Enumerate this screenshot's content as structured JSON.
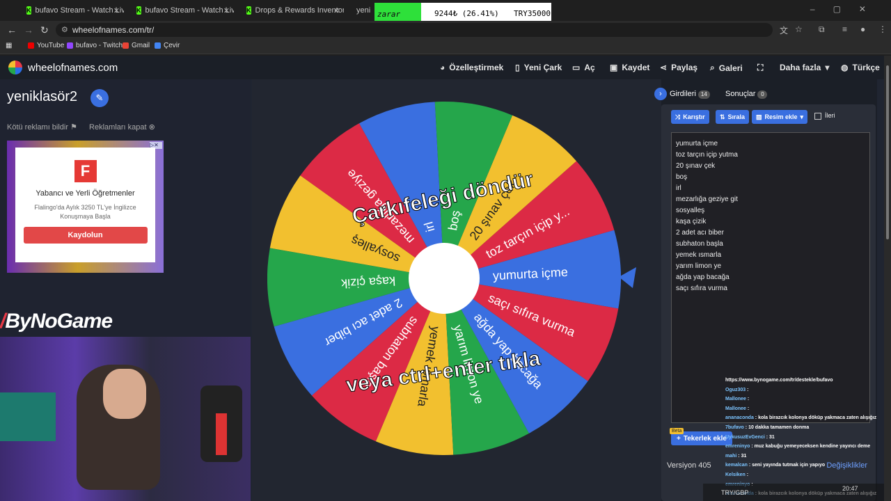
{
  "browser": {
    "tabs": [
      {
        "label": "bufavo Stream - Watch Live on"
      },
      {
        "label": "bufavo Stream - Watch Live on"
      },
      {
        "label": "Drops & Rewards Inventory - K"
      },
      {
        "label": "yeni"
      }
    ],
    "url": "wheelofnames.com/tr/",
    "bookmarks": [
      "YouTube",
      "bufavo - Twitch",
      "Gmail",
      "Çevir"
    ]
  },
  "stock_overlay": {
    "label": "zarar",
    "value1": "9244₺ (26.41%)",
    "value2": "TRY35000"
  },
  "site": {
    "brand": "wheelofnames.com",
    "nav": {
      "customize": "Özelleştirmek",
      "new_wheel": "Yeni Çark",
      "open": "Aç",
      "save": "Kaydet",
      "share": "Paylaş",
      "gallery": "Galeri",
      "more": "Daha fazla",
      "language": "Türkçe"
    },
    "wheel_title": "yeniklasör2",
    "ad_links": {
      "report": "Kötü reklamı bildir",
      "close": "Reklamları kapat"
    },
    "ad": {
      "logo": "F",
      "headline": "Yabancı ve Yerli Öğretmenler",
      "sub": "Flalingo'da Aylık 3250 TL'ye İngilizce Konuşmaya Başla",
      "cta": "Kaydolun"
    },
    "stream_logo": "ByNoGame",
    "wheel": {
      "overlay_top": "Çarkıfeleği döndür",
      "overlay_bottom": "veya ctrl+enter tıkla",
      "segments": [
        {
          "label": "yumurta içme",
          "color": "#3a6fe0"
        },
        {
          "label": "toz tarçın içip y...",
          "color": "#dc2a45"
        },
        {
          "label": "20 şınav çek",
          "color": "#f2c02f"
        },
        {
          "label": "boş",
          "color": "#25a64b"
        },
        {
          "label": "irl",
          "color": "#3a6fe0"
        },
        {
          "label": "mezarlığa geziye",
          "color": "#dc2a45"
        },
        {
          "label": "sosyalleş",
          "color": "#f2c02f"
        },
        {
          "label": "kaşa çizik",
          "color": "#25a64b"
        },
        {
          "label": "2 adet acı biber",
          "color": "#3a6fe0"
        },
        {
          "label": "subhaton başla",
          "color": "#dc2a45"
        },
        {
          "label": "yemek ısmarla",
          "color": "#f2c02f"
        },
        {
          "label": "yarım limon ye",
          "color": "#25a64b"
        },
        {
          "label": "ağda yap bacağa",
          "color": "#3a6fe0"
        },
        {
          "label": "saçı sıfıra vurma",
          "color": "#dc2a45"
        }
      ]
    },
    "panel": {
      "tab_entries": "Girdileri",
      "tab_entries_count": "14",
      "tab_results": "Sonuçlar",
      "tab_results_count": "0",
      "shuffle": "Karıştır",
      "sort": "Sırala",
      "add_image": "Resim ekle",
      "advanced": "İleri",
      "entries": [
        "yumurta içme",
        "toz tarçın içip yutma",
        "20 şınav çek",
        "boş",
        "irl",
        "mezarlığa geziye git",
        "sosyalleş",
        "kaşa çizik",
        "2 adet acı biber",
        "subhaton başla",
        "yemek ısmarla",
        "yarım limon ye",
        "ağda yap bacağa",
        "saçı sıfıra vurma"
      ],
      "beta": "Beta",
      "add_wheel": "Tekerlek ekle",
      "version": "Versiyon 405",
      "changes": "Değişiklikler"
    }
  },
  "chat": [
    {
      "user": "",
      "msg": "https://www.bynogame.com/tr/destekle/bufavo"
    },
    {
      "user": "Oguz303",
      "msg": ":"
    },
    {
      "user": "Mallonee",
      "msg": ":"
    },
    {
      "user": "Mallonee",
      "msg": ":"
    },
    {
      "user": "ananaconda",
      "msg": ": kola birazcık kolonya döküp yakmaca zaten alışığız"
    },
    {
      "user": "7bufavo",
      "msg": ": 10 dakka tamamen donma"
    },
    {
      "user": "UykusuzEvGenci",
      "msg": ": 31"
    },
    {
      "user": "emreninyo",
      "msg": ": muz kabuğu yemeyeceksen kendine yayıncı deme"
    },
    {
      "user": "mahi",
      "msg": ": 31"
    },
    {
      "user": "kemalcan",
      "msg": ": seni yayında tutmak için yapıyo"
    },
    {
      "user": "Kelsiken",
      "msg": ":"
    },
    {
      "user": "emreninyo",
      "msg": ":"
    },
    {
      "user": "ananaconda",
      "msg": ": kola birazcık kolonya döküp yakmaca zaten alışığız"
    }
  ],
  "taskbar": {
    "currency": "TRY/GBP",
    "time": "20:47"
  }
}
